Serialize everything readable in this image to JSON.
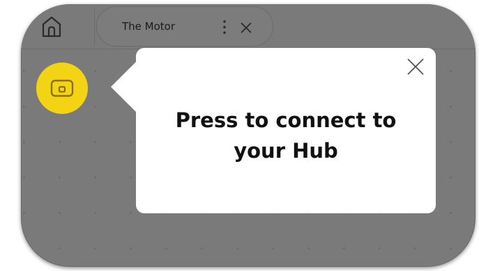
{
  "header": {
    "home_icon": "home-icon",
    "tab": {
      "title": "The Motor",
      "menu_icon": "vertical-dots-icon",
      "close_icon": "close-icon"
    }
  },
  "connect_button": {
    "icon": "hub-icon",
    "color": "#f3d414"
  },
  "popup": {
    "message_line1": "Press to connect to",
    "message_line2": "your Hub",
    "close_icon": "close-icon"
  },
  "colors": {
    "overlay": "#7a7a7a",
    "popup_bg": "#ffffff",
    "accent": "#f3d414"
  }
}
